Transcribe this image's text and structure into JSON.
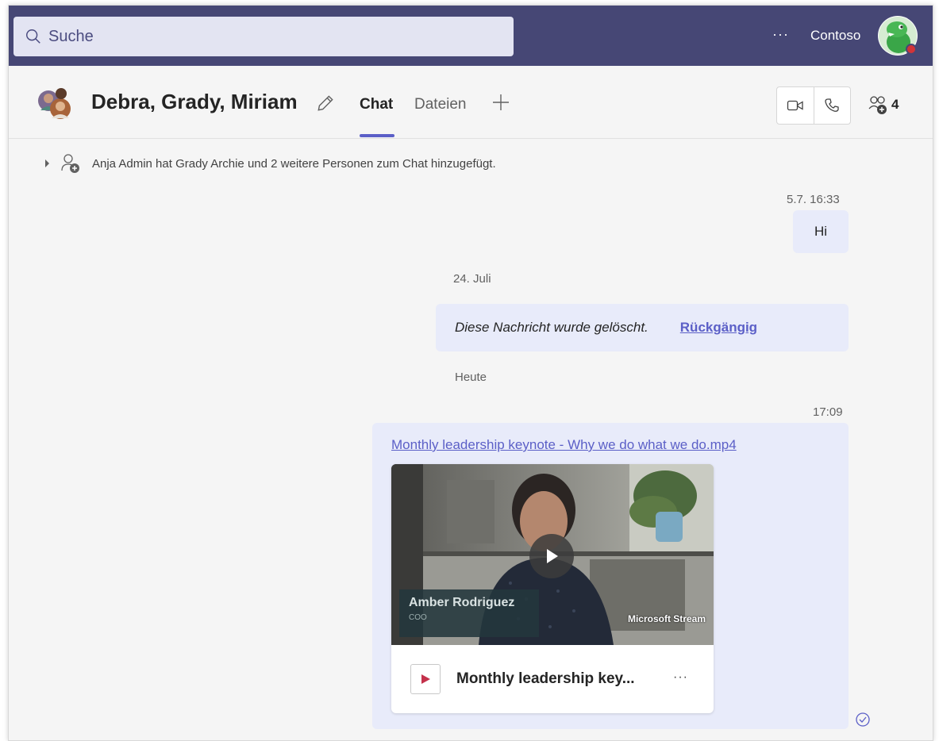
{
  "search": {
    "placeholder": "Suche"
  },
  "topbar": {
    "more": "···",
    "org": "Contoso"
  },
  "header": {
    "title": "Debra, Grady, Miriam",
    "tabs": [
      {
        "label": "Chat",
        "active": true
      },
      {
        "label": "Dateien",
        "active": false
      }
    ],
    "people_count": "4"
  },
  "messages": {
    "system": "Anja Admin hat Grady Archie und 2 weitere Personen zum Chat hinzugefügt.",
    "hi_time": "5.7. 16:33",
    "hi_text": "Hi",
    "date_july": "24. Juli",
    "deleted_text": "Diese Nachricht wurde gelöscht.",
    "undo": "Rückgängig",
    "date_today": "Heute",
    "video_time": "17:09",
    "file_link": "Monthly leadership keynote - Why we do what we do.mp4",
    "presenter_name": "Amber Rodriguez",
    "presenter_role": "COO",
    "stream_brand": "Microsoft Stream",
    "card_title": "Monthly leadership key...",
    "card_more": "···"
  },
  "colors": {
    "topbar": "#464775",
    "accent": "#5b5fc7",
    "bubble": "#e8ebfa",
    "background": "#f5f5f5"
  }
}
